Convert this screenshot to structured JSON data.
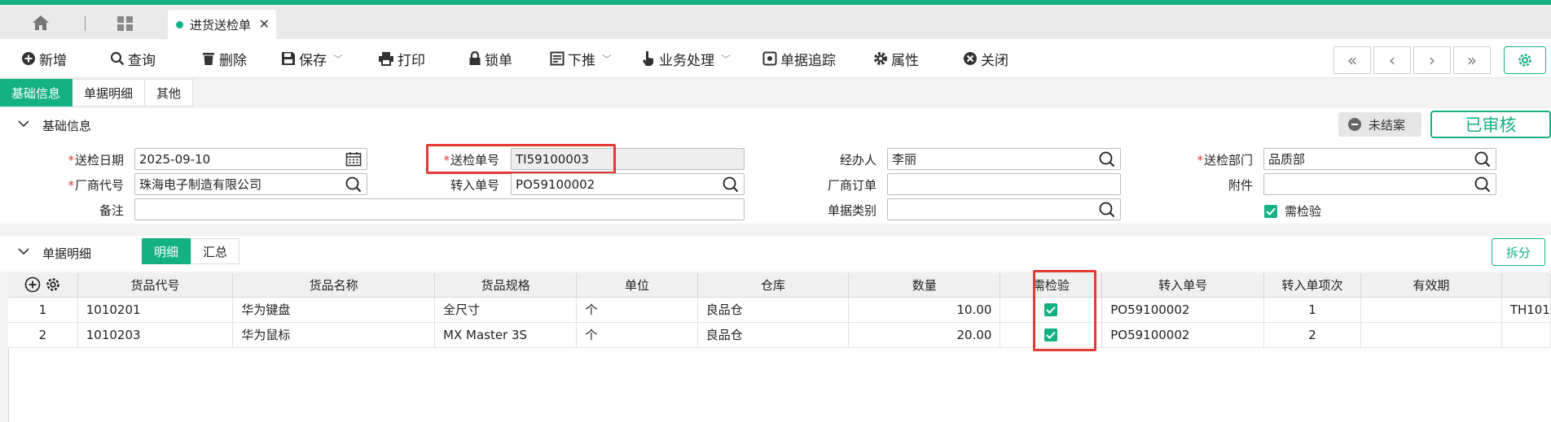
{
  "tabs": {
    "active_doc": "进货送检单"
  },
  "toolbar": {
    "add": "新增",
    "query": "查询",
    "delete": "删除",
    "save": "保存",
    "print": "打印",
    "lock": "锁单",
    "push_down": "下推",
    "business": "业务处理",
    "trace": "单据追踪",
    "attributes": "属性",
    "close": "关闭"
  },
  "subtabs": [
    "基础信息",
    "单据明细",
    "其他"
  ],
  "basic_section": {
    "title": "基础信息"
  },
  "status": {
    "unclosed": "未结案",
    "approved": "已审核"
  },
  "form": {
    "inspect_date_label": "送检日期",
    "inspect_date": "2025-09-10",
    "inspect_no_label": "送检单号",
    "inspect_no": "TI59100003",
    "handler_label": "经办人",
    "handler": "李丽",
    "dept_label": "送检部门",
    "dept": "品质部",
    "vendor_code_label": "厂商代号",
    "vendor_code": "珠海电子制造有限公司",
    "transfer_no_label": "转入单号",
    "transfer_no": "PO59100002",
    "vendor_order_label": "厂商订单",
    "vendor_order": "",
    "attachment_label": "附件",
    "attachment": "",
    "remark_label": "备注",
    "remark": "",
    "doc_type_label": "单据类别",
    "doc_type": "",
    "need_inspect_label": "需检验"
  },
  "detail_section": {
    "title": "单据明细",
    "seg_detail": "明细",
    "seg_summary": "汇总",
    "split": "拆分"
  },
  "grid": {
    "columns": [
      "货品代号",
      "货品名称",
      "货品规格",
      "单位",
      "仓库",
      "数量",
      "需检验",
      "转入单号",
      "转入单项次",
      "有效期"
    ],
    "rows": [
      {
        "idx": "1",
        "code": "1010201",
        "name": "华为键盘",
        "spec": "全尺寸",
        "unit": "个",
        "wh": "良品仓",
        "qty": "10.00",
        "transfer": "PO59100002",
        "item": "1",
        "expiry": "",
        "extra": "TH101"
      },
      {
        "idx": "2",
        "code": "1010203",
        "name": "华为鼠标",
        "spec": "MX Master 3S",
        "unit": "个",
        "wh": "良品仓",
        "qty": "20.00",
        "transfer": "PO59100002",
        "item": "2",
        "expiry": "",
        "extra": ""
      }
    ]
  },
  "colors": {
    "accent": "#14b185",
    "highlight": "#e53935"
  }
}
